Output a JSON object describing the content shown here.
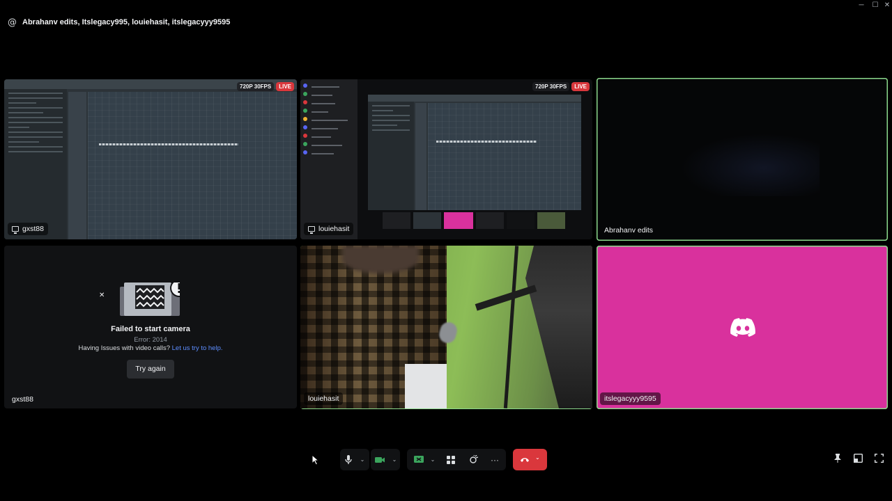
{
  "window": {
    "minimize": "─",
    "maximize": "☐",
    "close": "✕"
  },
  "header": {
    "icon": "at-icon",
    "title": "Abrahanv edits, Itslegacy995, louiehasit, itslegacyyy9595"
  },
  "tiles": [
    {
      "name": "gxst88",
      "type": "screen-share",
      "resolution": "720P 30FPS",
      "live": "LIVE"
    },
    {
      "name": "louiehasit",
      "type": "screen-share",
      "resolution": "720P 30FPS",
      "live": "LIVE"
    },
    {
      "name": "Abrahanv edits",
      "type": "camera-dark",
      "speaking": true
    },
    {
      "name": "gxst88",
      "type": "camera-failed"
    },
    {
      "name": "louiehasit",
      "type": "camera",
      "speaking": true
    },
    {
      "name": "itslegacyyy9595",
      "type": "avatar",
      "speaking": true
    }
  ],
  "camera_error": {
    "title": "Failed to start camera",
    "error": "Error: 2014",
    "help_text": "Having Issues with video calls?",
    "help_link": "Let us try to help.",
    "button": "Try again"
  },
  "controls": {
    "icons": [
      "mic-icon",
      "camera-icon",
      "screen-share-icon",
      "activities-icon",
      "soundboard-icon",
      "more-icon",
      "leave-call-icon",
      "pin-icon",
      "popout-icon",
      "fullscreen-icon"
    ],
    "more": "···"
  },
  "colors": {
    "accent_green": "#8cd98c",
    "live_red": "#da373c",
    "pink_avatar": "#d9319d",
    "link_blue": "#5d8dff"
  }
}
